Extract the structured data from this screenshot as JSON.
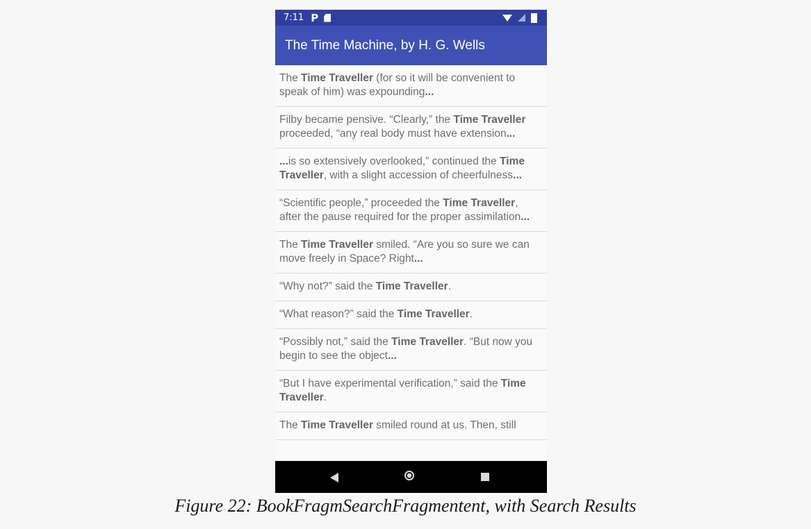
{
  "status_bar": {
    "time": "7:11",
    "p_glyph": "P",
    "icons": [
      "p-notification-icon",
      "sd-card-icon",
      "wifi-icon",
      "signal-icon",
      "battery-icon"
    ]
  },
  "app_bar": {
    "title": "The Time Machine, by H. G. Wells"
  },
  "results": [
    [
      {
        "t": "The "
      },
      {
        "t": "Time Traveller",
        "b": true
      },
      {
        "t": " (for so it will be convenient to speak of him) was expounding"
      },
      {
        "t": "...",
        "b": true
      }
    ],
    [
      {
        "t": "Filby became pensive. “Clearly,” the "
      },
      {
        "t": "Time Traveller",
        "b": true
      },
      {
        "t": " proceeded, “any real body must have extension"
      },
      {
        "t": "...",
        "b": true
      }
    ],
    [
      {
        "t": "...",
        "b": true
      },
      {
        "t": "is so extensively overlooked,” continued the "
      },
      {
        "t": "Time Traveller",
        "b": true
      },
      {
        "t": ", with a slight accession of cheerfulness"
      },
      {
        "t": "...",
        "b": true
      }
    ],
    [
      {
        "t": "“Scientific people,” proceeded the "
      },
      {
        "t": "Time Traveller",
        "b": true
      },
      {
        "t": ", after the pause required for the proper assimilation"
      },
      {
        "t": "...",
        "b": true
      }
    ],
    [
      {
        "t": "The "
      },
      {
        "t": "Time Traveller",
        "b": true
      },
      {
        "t": " smiled. “Are you so sure we can move freely in Space? Right"
      },
      {
        "t": "...",
        "b": true
      }
    ],
    [
      {
        "t": "“Why not?” said the "
      },
      {
        "t": "Time Traveller",
        "b": true
      },
      {
        "t": "."
      }
    ],
    [
      {
        "t": "“What reason?” said the "
      },
      {
        "t": "Time Traveller",
        "b": true
      },
      {
        "t": "."
      }
    ],
    [
      {
        "t": "“Possibly not,” said the "
      },
      {
        "t": "Time Traveller",
        "b": true
      },
      {
        "t": ". “But now you begin to see the object"
      },
      {
        "t": "...",
        "b": true
      }
    ],
    [
      {
        "t": "“But I have experimental verification,” said the "
      },
      {
        "t": "Time Traveller",
        "b": true
      },
      {
        "t": "."
      }
    ],
    [
      {
        "t": "The "
      },
      {
        "t": "Time Traveller",
        "b": true
      },
      {
        "t": " smiled round at us. Then, still"
      }
    ]
  ],
  "nav_bar": {
    "icons": [
      "back-icon",
      "home-icon",
      "recents-icon"
    ]
  },
  "caption": "Figure 22: BookFragmSearchFragmentent, with Search Results",
  "colors": {
    "status_bar": "#303f9f",
    "app_bar": "#3f51b5",
    "nav_bar": "#000000"
  }
}
